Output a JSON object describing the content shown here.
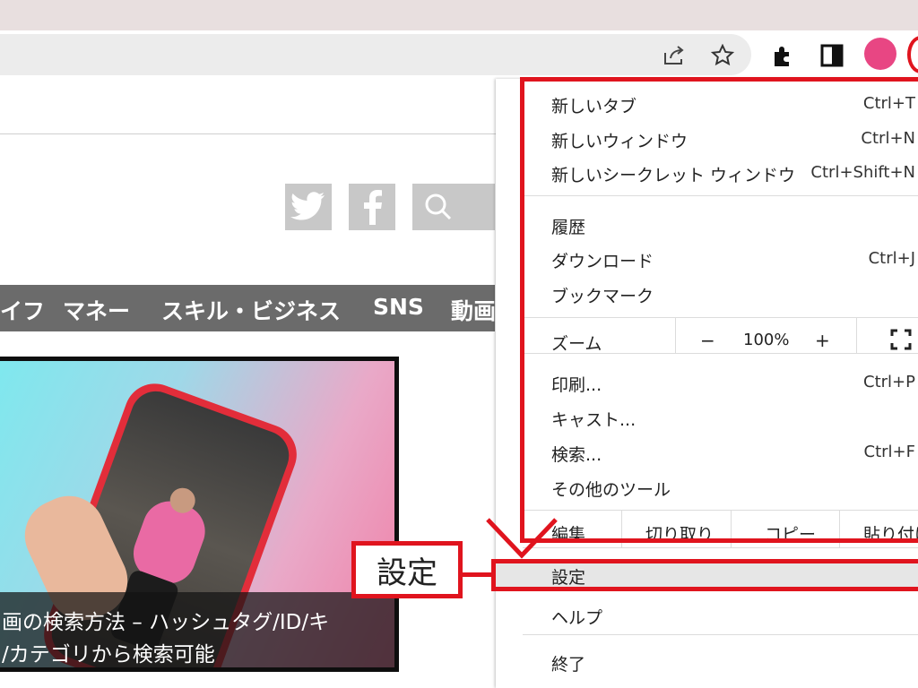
{
  "browser": {
    "icons": [
      "share-icon",
      "star-icon",
      "extensions-icon",
      "side-panel-icon",
      "profile-avatar",
      "menu-icon"
    ],
    "avatar_color": "#e84683"
  },
  "site": {
    "social_icons": [
      "twitter-icon",
      "facebook-icon",
      "search-icon"
    ],
    "nav": [
      "イフ",
      "マネー",
      "スキル・ビジネス",
      "SNS",
      "動画"
    ],
    "article": {
      "caption_line1": "画の検索方法 – ハッシュタグ/ID/キ",
      "caption_line2": "/カテゴリから検索可能"
    }
  },
  "menu": {
    "new_tab": {
      "label": "新しいタブ",
      "shortcut": "Ctrl+T"
    },
    "new_window": {
      "label": "新しいウィンドウ",
      "shortcut": "Ctrl+N"
    },
    "incognito": {
      "label": "新しいシークレット ウィンドウ",
      "shortcut": "Ctrl+Shift+N"
    },
    "history": {
      "label": "履歴"
    },
    "downloads": {
      "label": "ダウンロード",
      "shortcut": "Ctrl+J"
    },
    "bookmarks": {
      "label": "ブックマーク"
    },
    "zoom": {
      "label": "ズーム",
      "minus": "−",
      "value": "100%",
      "plus": "+"
    },
    "print": {
      "label": "印刷...",
      "shortcut": "Ctrl+P"
    },
    "cast": {
      "label": "キャスト..."
    },
    "find": {
      "label": "検索...",
      "shortcut": "Ctrl+F"
    },
    "more_tools": {
      "label": "その他のツール"
    },
    "edit": {
      "label": "編集",
      "cut": "切り取り",
      "copy": "コピー",
      "paste": "貼り付け"
    },
    "settings": {
      "label": "設定"
    },
    "help": {
      "label": "ヘルプ"
    },
    "exit": {
      "label": "終了"
    }
  },
  "annotation": {
    "label": "設定",
    "color": "#e0141e"
  }
}
